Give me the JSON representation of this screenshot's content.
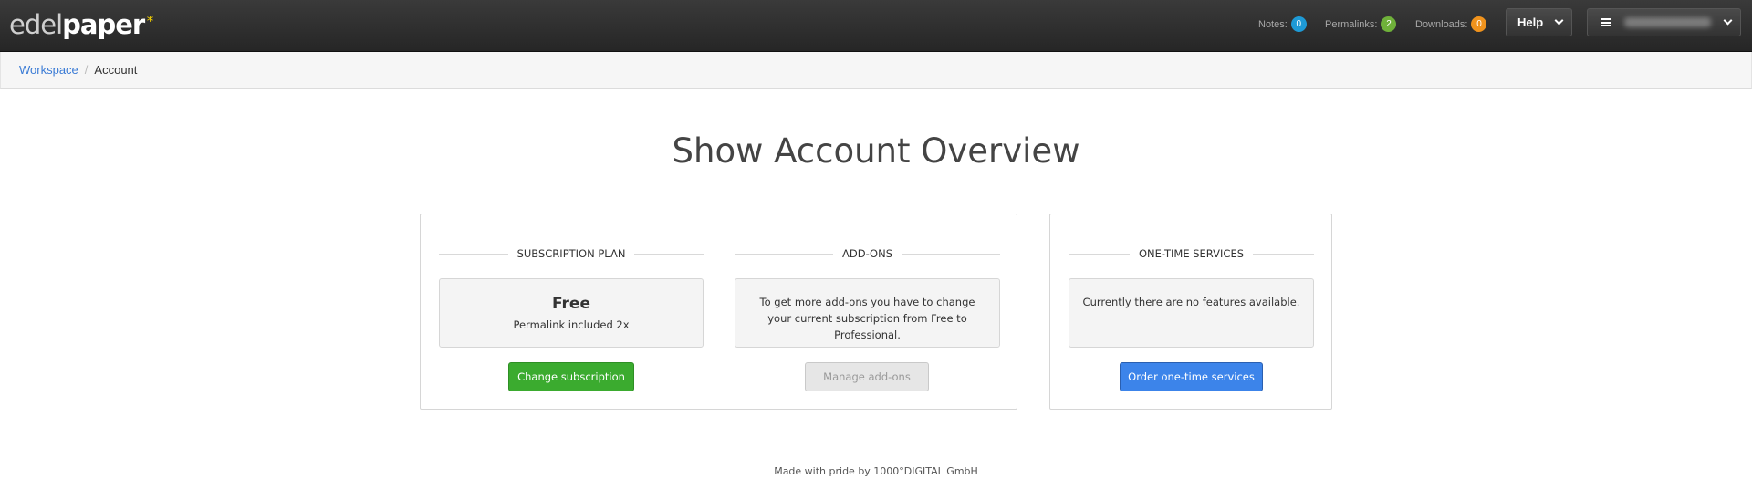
{
  "brand": {
    "part1": "edel",
    "part2": "paper",
    "star": "*"
  },
  "header": {
    "counters": [
      {
        "label": "Notes:",
        "count": "0",
        "color": "#1e9ad6"
      },
      {
        "label": "Permalinks:",
        "count": "2",
        "color": "#6fb13a"
      },
      {
        "label": "Downloads:",
        "count": "0",
        "color": "#f0931d"
      }
    ],
    "help_label": "Help",
    "menu_icon": "hamburger-icon"
  },
  "breadcrumb": {
    "items": [
      "Workspace",
      "Account"
    ]
  },
  "page": {
    "title": "Show Account Overview"
  },
  "subscription": {
    "heading": "SUBSCRIPTION PLAN",
    "plan_name": "Free",
    "plan_desc": "Permalink included 2x",
    "button": "Change subscription"
  },
  "addons": {
    "heading": "ADD-ONS",
    "text": "To get more add-ons you have to change your current subscription from Free to Professional.",
    "button": "Manage add-ons"
  },
  "services": {
    "heading": "ONE-TIME SERVICES",
    "text": "Currently there are no features available.",
    "button": "Order one-time services"
  },
  "footer": {
    "text": "Made with pride by 1000°DIGITAL GmbH"
  },
  "colors": {
    "green": "#3bab2f",
    "blue": "#3c84ea",
    "link": "#3a7bd5"
  }
}
